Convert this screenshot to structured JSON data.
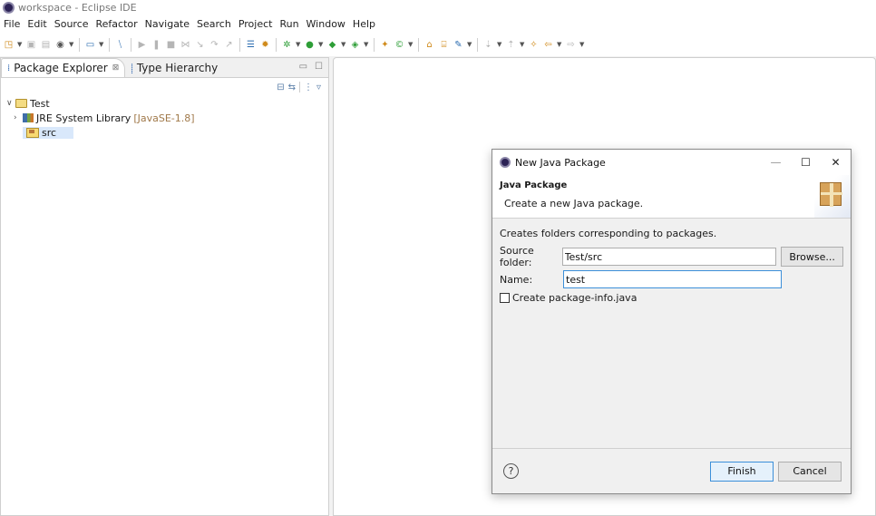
{
  "window": {
    "title": "workspace - Eclipse IDE",
    "icon": "eclipse-icon"
  },
  "menubar": {
    "items": [
      "File",
      "Edit",
      "Source",
      "Refactor",
      "Navigate",
      "Search",
      "Project",
      "Run",
      "Window",
      "Help"
    ]
  },
  "left_pane": {
    "tabs": [
      {
        "label": "Package Explorer",
        "close": "⊠"
      },
      {
        "label": "Type Hierarchy"
      }
    ],
    "tree": {
      "project": {
        "label": "Test"
      },
      "jre": {
        "label": "JRE System Library",
        "version": "[JavaSE-1.8]"
      },
      "src": {
        "label": "src"
      }
    }
  },
  "dialog": {
    "title": "New Java Package",
    "header_title": "Java Package",
    "header_desc": "Create a new Java package.",
    "body_desc": "Creates folders corresponding to packages.",
    "source_folder_label": "Source folder:",
    "source_folder_value": "Test/src",
    "browse_label": "Browse...",
    "name_label": "Name:",
    "name_value": "test",
    "checkbox_label": "Create package-info.java",
    "help_glyph": "?",
    "finish_label": "Finish",
    "cancel_label": "Cancel",
    "win_buttons": {
      "minimize": "—",
      "maximize": "☐",
      "close": "✕"
    }
  },
  "colors": {
    "accent": "#3c8fd9",
    "selection": "#d9e8fb",
    "jre_version": "#a0794a"
  }
}
